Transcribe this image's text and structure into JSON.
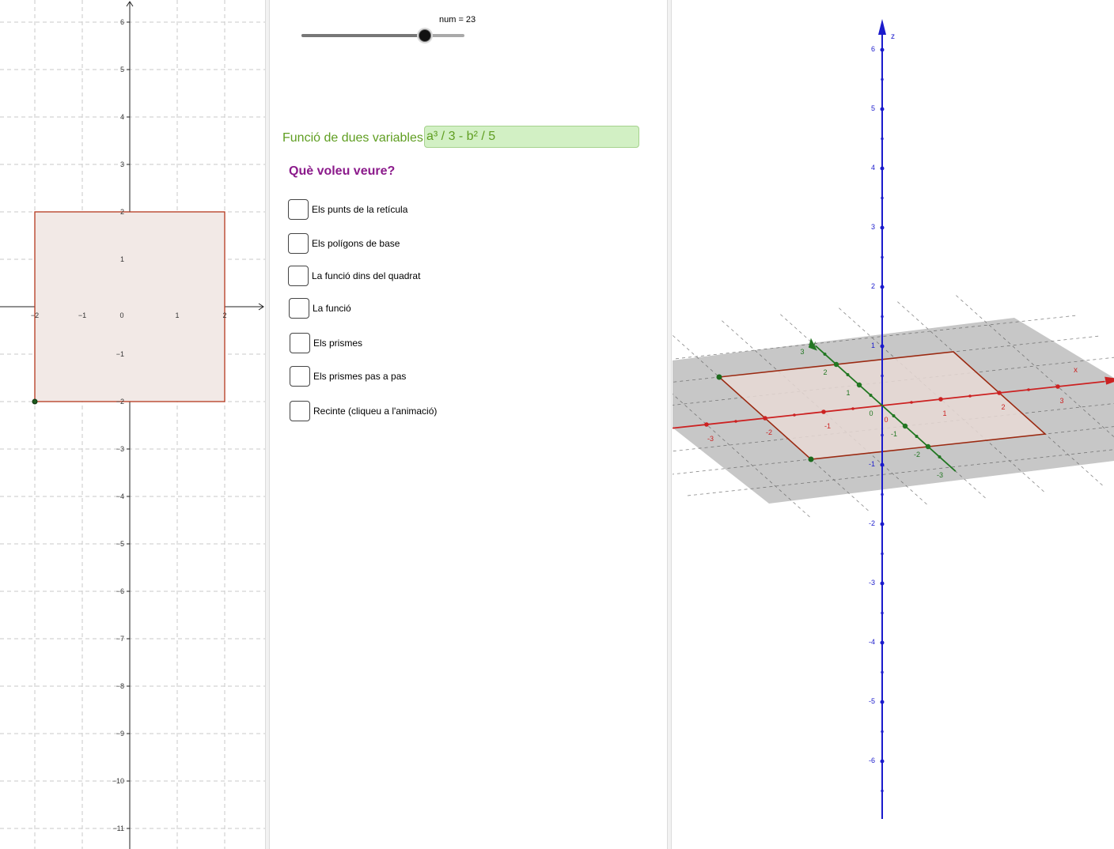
{
  "slider": {
    "label": "num = 23",
    "value": 23,
    "min": 1,
    "max": 30
  },
  "algebra": {
    "function_label": "Funció de dues variables",
    "function_value": "a³ / 3 - b² / 5",
    "question": "Què voleu veure?",
    "checkboxes": [
      {
        "label": "Els punts de la retícula",
        "checked": false
      },
      {
        "label": "Els polígons de base",
        "checked": false
      },
      {
        "label": "La funció dins del quadrat",
        "checked": false
      },
      {
        "label": "La funció",
        "checked": false
      },
      {
        "label": "Els prismes",
        "checked": false
      },
      {
        "label": "Els prismes pas a pas",
        "checked": false
      },
      {
        "label": "Recinte (cliqueu a l'animació)",
        "checked": false
      }
    ]
  },
  "graphics2d": {
    "x_ticks": [
      "−2",
      "−1",
      "0",
      "1",
      "2"
    ],
    "y_ticks": [
      "6",
      "5",
      "4",
      "3",
      "2",
      "1",
      "−1",
      "−2",
      "−3",
      "−4",
      "−5",
      "−6",
      "−7",
      "−8",
      "−9",
      "−10",
      "−11"
    ],
    "square": {
      "x_range": [
        -2,
        2
      ],
      "y_range": [
        -2,
        2
      ],
      "fill": "#f2e9e6",
      "stroke": "#b5391f"
    },
    "point": {
      "x": -2,
      "y": -2
    }
  },
  "graphics3d": {
    "axis_labels": {
      "x": "x",
      "y": "y",
      "z": "z"
    },
    "z_ticks": [
      "6",
      "5",
      "4",
      "3",
      "2",
      "1",
      "-1",
      "-2",
      "-3",
      "-4",
      "-5",
      "-6"
    ],
    "x_ticks": [
      "-3",
      "-2",
      "-1",
      "0",
      "1",
      "2",
      "3"
    ],
    "y_ticks": [
      "-3",
      "-2",
      "-1",
      "0",
      "1",
      "2",
      "3"
    ],
    "colors": {
      "x_axis": "#cc2222",
      "y_axis": "#227722",
      "z_axis": "#1a1acc",
      "plane": "#c7c7c7",
      "square_stroke": "#9b2a12"
    }
  }
}
